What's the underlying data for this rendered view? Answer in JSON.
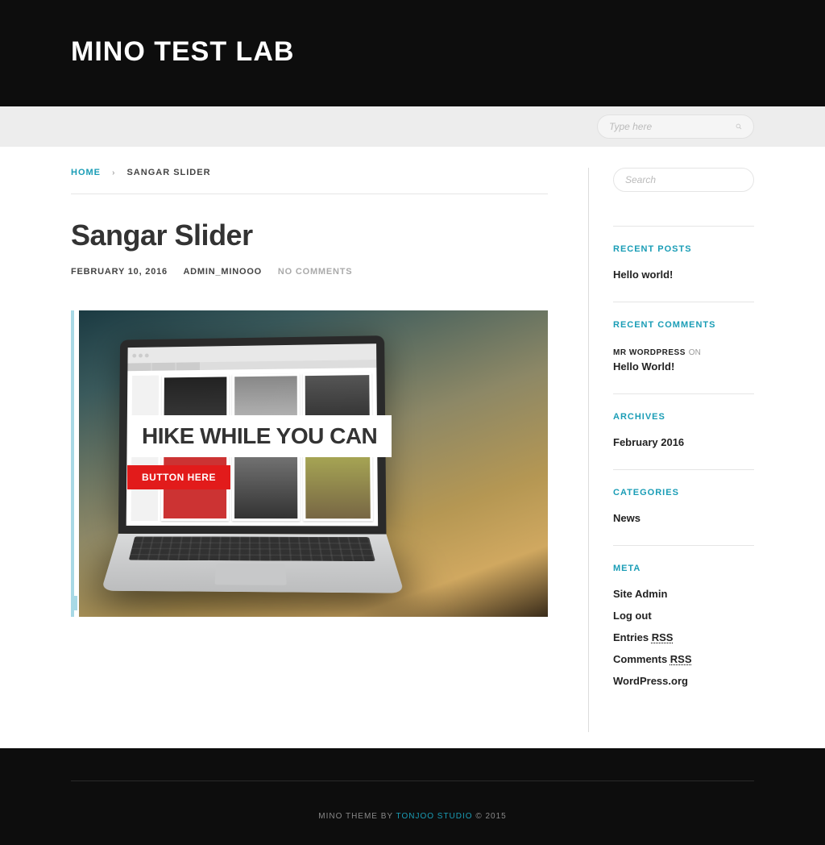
{
  "header": {
    "site_title": "MINO TEST LAB"
  },
  "nav": {
    "search_placeholder": "Type here"
  },
  "breadcrumb": {
    "home": "HOME",
    "current": "SANGAR SLIDER"
  },
  "post": {
    "title": "Sangar Slider",
    "date": "FEBRUARY 10, 2016",
    "author": "ADMIN_MINOOO",
    "comments": "NO COMMENTS",
    "slide_caption": "HIKE WHILE YOU CAN",
    "slide_button": "BUTTON HERE"
  },
  "sidebar": {
    "search_placeholder": "Search",
    "recent_posts": {
      "title": "RECENT POSTS",
      "items": [
        "Hello world!"
      ]
    },
    "recent_comments": {
      "title": "RECENT COMMENTS",
      "author": "MR WORDPRESS",
      "on": "ON",
      "target": "Hello World!"
    },
    "archives": {
      "title": "ARCHIVES",
      "items": [
        "February 2016"
      ]
    },
    "categories": {
      "title": "CATEGORIES",
      "items": [
        "News"
      ]
    },
    "meta": {
      "title": "META",
      "items": [
        {
          "label": "Site Admin",
          "suffix": ""
        },
        {
          "label": "Log out",
          "suffix": ""
        },
        {
          "label": "Entries ",
          "suffix": "RSS"
        },
        {
          "label": "Comments ",
          "suffix": "RSS"
        },
        {
          "label": "WordPress.org",
          "suffix": ""
        }
      ]
    }
  },
  "footer": {
    "prefix": "MINO THEME BY ",
    "link": "TONJOO STUDIO",
    "copy": " © 2015"
  }
}
